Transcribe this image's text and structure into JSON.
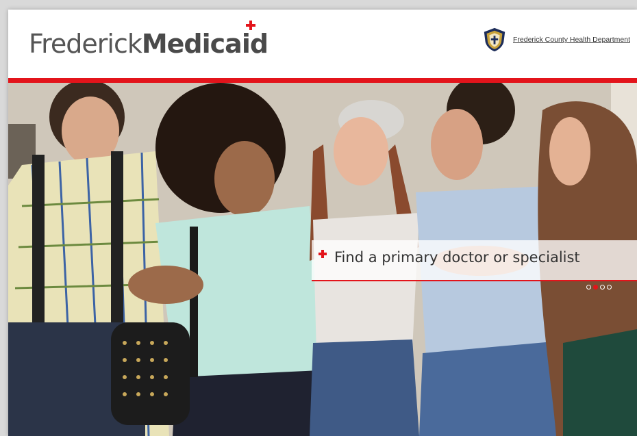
{
  "header": {
    "logo_light": "Frederick",
    "logo_bold": "Medicaid",
    "department_link": "Frederick County Health Department"
  },
  "hero": {
    "caption": "Find a primary doctor or specialist",
    "slides_count": 4,
    "active_slide": 2
  },
  "colors": {
    "accent_red": "#e3141b",
    "logo_gray": "#4a4a4a",
    "shield_navy": "#1d2d5a",
    "shield_gold": "#c9a23a"
  },
  "icons": {
    "logo_mark": "red-cross-icon",
    "department": "health-department-shield-icon",
    "caption_mark": "red-plus-icon"
  }
}
